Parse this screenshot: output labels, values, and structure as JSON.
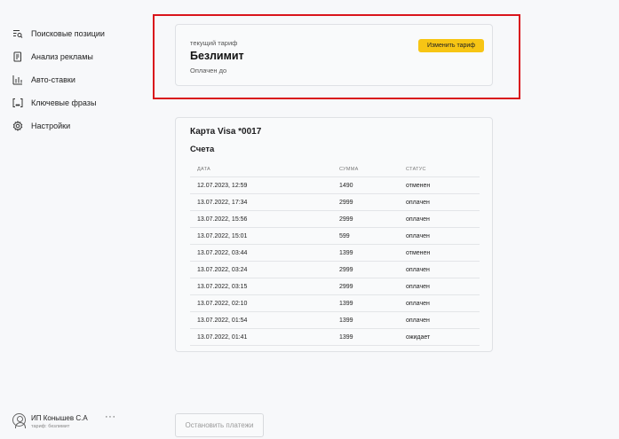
{
  "sidebar": {
    "items": [
      {
        "label": "Поисковые позиции",
        "icon": "search-list-icon"
      },
      {
        "label": "Анализ рекламы",
        "icon": "document-icon"
      },
      {
        "label": "Авто-ставки",
        "icon": "bar-chart-icon"
      },
      {
        "label": "Ключевые фразы",
        "icon": "brackets-icon"
      },
      {
        "label": "Настройки",
        "icon": "gear-icon"
      }
    ]
  },
  "user": {
    "name": "ИП Конышев С.А",
    "plan": "тариф: безлимит",
    "more": "···"
  },
  "tariff": {
    "label": "текущий тариф",
    "name": "Безлимит",
    "paid_until": "Оплачен до",
    "change_button": "Изменить тариф"
  },
  "card": {
    "title": "Карта Visa *0017"
  },
  "bills": {
    "title": "Счета",
    "columns": {
      "date": "ДАТА",
      "sum": "СУММА",
      "status": "СТАТУС"
    },
    "rows": [
      {
        "date": "12.07.2023, 12:59",
        "sum": "1490",
        "status": "отменен"
      },
      {
        "date": "13.07.2022, 17:34",
        "sum": "2999",
        "status": "оплачен"
      },
      {
        "date": "13.07.2022, 15:56",
        "sum": "2999",
        "status": "оплачен"
      },
      {
        "date": "13.07.2022, 15:01",
        "sum": "599",
        "status": "оплачен"
      },
      {
        "date": "13.07.2022, 03:44",
        "sum": "1399",
        "status": "отменен"
      },
      {
        "date": "13.07.2022, 03:24",
        "sum": "2999",
        "status": "оплачен"
      },
      {
        "date": "13.07.2022, 03:15",
        "sum": "2999",
        "status": "оплачен"
      },
      {
        "date": "13.07.2022, 02:10",
        "sum": "1399",
        "status": "оплачен"
      },
      {
        "date": "13.07.2022, 01:54",
        "sum": "1399",
        "status": "оплачен"
      },
      {
        "date": "13.07.2022, 01:41",
        "sum": "1399",
        "status": "ожидает"
      }
    ]
  },
  "stop_button": "Остановить платежи",
  "colors": {
    "accent": "#f7c514",
    "highlight": "#d9141b",
    "background": "#f7f8fa"
  }
}
